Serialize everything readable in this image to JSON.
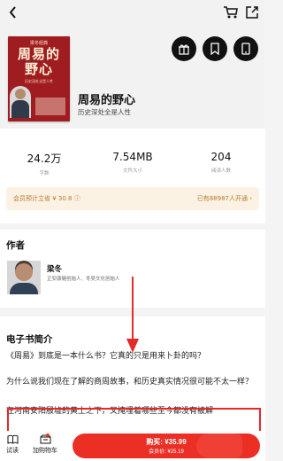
{
  "book": {
    "cover_small": "梁冬经典",
    "cover_title": "周易的\n野心",
    "cover_sub": "历史深处全是人性",
    "title": "周易的野心",
    "description": "历史深处全是人性"
  },
  "stats": [
    {
      "value": "24.2万",
      "label": "字数"
    },
    {
      "value": "7.54MB",
      "label": "文件大小"
    },
    {
      "value": "204",
      "label": "阅读人数"
    }
  ],
  "member": {
    "left": "会员预计立省 ¥ 30.8 ⓘ",
    "right": "已有88987人开通 ›"
  },
  "author": {
    "section_title": "作者",
    "name": "梁冬",
    "bio": "正安康健创始人、冬吴文化创始人"
  },
  "intro": {
    "section_title": "电子书简介",
    "p1": "《周易》到底是一本什么书？它真的只是用来卜卦的吗？",
    "p2": "为什么说我们现在了解的商周故事，和历史真实情况很可能不太一样？",
    "p3": "在河南安阳殷墟的黄土之下，又掩埋着哪些至今都没有被解"
  },
  "actions": {
    "try_label": "试读",
    "cart_label": "加购物车",
    "buy_main": "购买: ¥35.99",
    "buy_sub": "会员价: ¥25.19"
  },
  "icons": {
    "back": "back-chevron-icon",
    "cart": "shopping-cart-icon",
    "share": "share-icon",
    "gift": "gift-icon",
    "bookmark": "bookmark-icon",
    "reader": "tablet-icon",
    "book": "book-icon",
    "store": "store-icon"
  },
  "colors": {
    "accent": "#eb2f25",
    "member_text": "#b87a2c",
    "member_bg": "#fbf2e4",
    "cover": "#9f1d21"
  }
}
